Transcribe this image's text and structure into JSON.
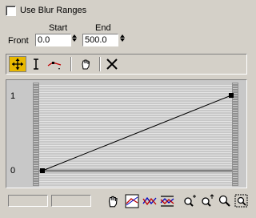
{
  "blur": {
    "checkbox_label": "Use Blur Ranges",
    "checked": false
  },
  "ranges": {
    "start_label": "Start",
    "end_label": "End",
    "row_label": "Front",
    "start_value": "0.0",
    "end_value": "500.0"
  },
  "toolbar": {
    "icons": [
      "move-control-point-icon",
      "scale-point-icon",
      "insert-corner-point-icon",
      "pan-hand-icon",
      "delete-point-icon"
    ]
  },
  "graph": {
    "y_labels": [
      "1",
      "0"
    ],
    "curve_points": [
      [
        0.0,
        0.0
      ],
      [
        1.0,
        1.0
      ]
    ]
  },
  "bottom": {
    "field1_value": "",
    "field2_value": "",
    "icons": [
      "pan-hand-icon",
      "zoom-extents-icon",
      "zoom-horizontal-extents-icon",
      "zoom-value-extents-icon",
      "zoom-horizontal-icon",
      "zoom-vertical-icon",
      "zoom-icon",
      "zoom-region-icon"
    ]
  }
}
